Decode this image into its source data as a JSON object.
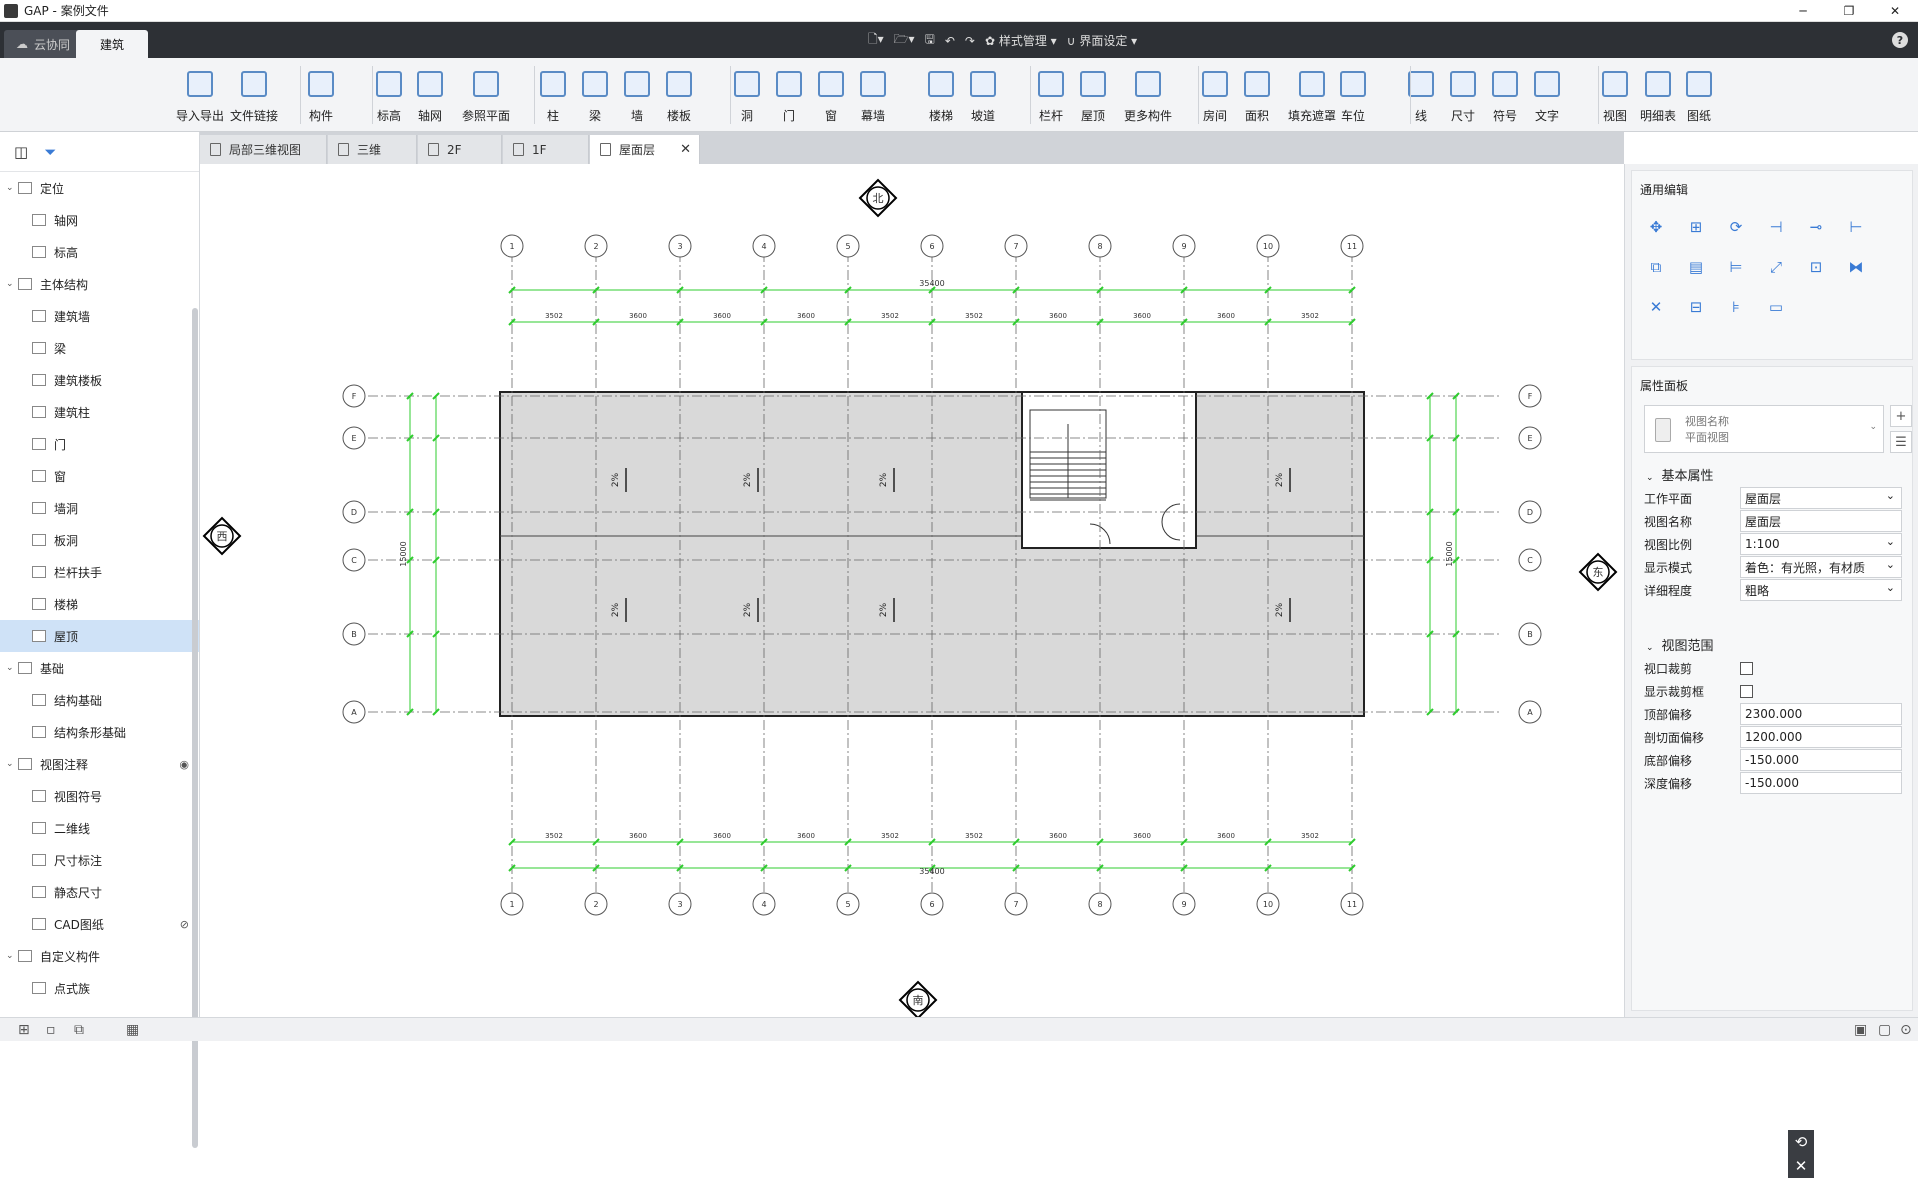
{
  "window": {
    "title": "GAP - 案例文件",
    "minimize": "─",
    "restore": "❐",
    "close": "✕"
  },
  "menubar": {
    "cloud_tab": "云协同",
    "active_tab": "建筑",
    "style_manage": "样式管理",
    "ui_settings": "界面设定",
    "help": "?"
  },
  "ribbon": [
    {
      "id": "import-export",
      "label": "导入导出",
      "icon": "cad-import-icon"
    },
    {
      "id": "file-link",
      "label": "文件链接",
      "icon": "file-link-icon"
    },
    {
      "id": "component",
      "label": "构件",
      "icon": "component-icon"
    },
    {
      "id": "level",
      "label": "标高",
      "icon": "level-icon"
    },
    {
      "id": "grid",
      "label": "轴网",
      "icon": "grid-icon"
    },
    {
      "id": "ref-plane",
      "label": "参照平面",
      "icon": "ref-plane-icon"
    },
    {
      "id": "column",
      "label": "柱",
      "icon": "column-icon"
    },
    {
      "id": "beam",
      "label": "梁",
      "icon": "beam-icon"
    },
    {
      "id": "wall",
      "label": "墙",
      "icon": "wall-icon"
    },
    {
      "id": "slab",
      "label": "楼板",
      "icon": "slab-icon"
    },
    {
      "id": "opening",
      "label": "洞",
      "icon": "opening-icon"
    },
    {
      "id": "door",
      "label": "门",
      "icon": "door-icon"
    },
    {
      "id": "window",
      "label": "窗",
      "icon": "window-icon"
    },
    {
      "id": "curtain-wall",
      "label": "幕墙",
      "icon": "curtain-wall-icon"
    },
    {
      "id": "stair",
      "label": "楼梯",
      "icon": "stair-icon"
    },
    {
      "id": "ramp",
      "label": "坡道",
      "icon": "ramp-icon"
    },
    {
      "id": "railing",
      "label": "栏杆",
      "icon": "railing-icon"
    },
    {
      "id": "roof",
      "label": "屋顶",
      "icon": "roof-icon"
    },
    {
      "id": "more-components",
      "label": "更多构件",
      "icon": "more-components-icon"
    },
    {
      "id": "room",
      "label": "房间",
      "icon": "room-icon"
    },
    {
      "id": "area",
      "label": "面积",
      "icon": "area-icon"
    },
    {
      "id": "fill-mask",
      "label": "填充遮罩",
      "icon": "fill-mask-icon"
    },
    {
      "id": "parking",
      "label": "车位",
      "icon": "parking-icon"
    },
    {
      "id": "line",
      "label": "线",
      "icon": "line-icon"
    },
    {
      "id": "dimension",
      "label": "尺寸",
      "icon": "dimension-icon"
    },
    {
      "id": "symbol",
      "label": "符号",
      "icon": "symbol-icon"
    },
    {
      "id": "text",
      "label": "文字",
      "icon": "text-icon"
    },
    {
      "id": "view",
      "label": "视图",
      "icon": "view-icon"
    },
    {
      "id": "schedule",
      "label": "明细表",
      "icon": "schedule-icon"
    },
    {
      "id": "drawing",
      "label": "图纸",
      "icon": "drawing-icon"
    }
  ],
  "view_tabs": [
    "局部三维视图",
    "三维",
    "2F",
    "1F",
    "屋面层"
  ],
  "tree": [
    {
      "label": "定位",
      "level": 1
    },
    {
      "label": "轴网",
      "level": 2
    },
    {
      "label": "标高",
      "level": 2
    },
    {
      "label": "主体结构",
      "level": 1
    },
    {
      "label": "建筑墙",
      "level": 2
    },
    {
      "label": "梁",
      "level": 2
    },
    {
      "label": "建筑楼板",
      "level": 2
    },
    {
      "label": "建筑柱",
      "level": 2
    },
    {
      "label": "门",
      "level": 2
    },
    {
      "label": "窗",
      "level": 2
    },
    {
      "label": "墙洞",
      "level": 2
    },
    {
      "label": "板洞",
      "level": 2
    },
    {
      "label": "栏杆扶手",
      "level": 2
    },
    {
      "label": "楼梯",
      "level": 2
    },
    {
      "label": "屋顶",
      "level": 2,
      "selected": true
    },
    {
      "label": "基础",
      "level": 1
    },
    {
      "label": "结构基础",
      "level": 2
    },
    {
      "label": "结构条形基础",
      "level": 2
    },
    {
      "label": "视图注释",
      "level": 1,
      "eye": "visible"
    },
    {
      "label": "视图符号",
      "level": 2
    },
    {
      "label": "二维线",
      "level": 2
    },
    {
      "label": "尺寸标注",
      "level": 2
    },
    {
      "label": "静态尺寸",
      "level": 2
    },
    {
      "label": "CAD图纸",
      "level": 2,
      "eye": "hidden"
    },
    {
      "label": "自定义构件",
      "level": 1
    },
    {
      "label": "点式族",
      "level": 2
    }
  ],
  "drawing": {
    "compass": {
      "north": "北",
      "south": "南",
      "west": "西",
      "east": "东"
    },
    "col_axes": [
      "1",
      "2",
      "3",
      "4",
      "5",
      "6",
      "7",
      "8",
      "9",
      "10",
      "11"
    ],
    "row_axes": [
      "F",
      "E",
      "D",
      "C",
      "B",
      "A"
    ],
    "top_total": "35400",
    "bottom_total": "35400",
    "spans": [
      "3502",
      "3600",
      "3600",
      "3600",
      "3502",
      "3502",
      "3600",
      "3600",
      "3600",
      "3502"
    ],
    "left_total": "15000",
    "right_total": "15000",
    "slope_labels": [
      "2%",
      "2%",
      "2%",
      "2%",
      "2%",
      "2%",
      "2%",
      "2%"
    ]
  },
  "right_panel": {
    "general_edit": "通用编辑",
    "properties": "属性面板",
    "view_name_label": "视图名称",
    "view_type": "平面视图",
    "basic": "基本属性",
    "view_range": "视图范围",
    "rows": [
      {
        "k": "工作平面",
        "v": "屋面层",
        "type": "select"
      },
      {
        "k": "视图名称",
        "v": "屋面层",
        "type": "text"
      },
      {
        "k": "视图比例",
        "v": "1:100",
        "type": "select"
      },
      {
        "k": "显示模式",
        "v": "着色：有光照，有材质",
        "type": "select"
      },
      {
        "k": "详细程度",
        "v": "粗略",
        "type": "select"
      }
    ],
    "range_rows": [
      {
        "k": "视口裁剪",
        "type": "check"
      },
      {
        "k": "显示裁剪框",
        "type": "check"
      },
      {
        "k": "顶部偏移",
        "v": "2300.000",
        "type": "text"
      },
      {
        "k": "剖切面偏移",
        "v": "1200.000",
        "type": "text"
      },
      {
        "k": "底部偏移",
        "v": "-150.000",
        "type": "text"
      },
      {
        "k": "深度偏移",
        "v": "-150.000",
        "type": "text"
      }
    ]
  }
}
